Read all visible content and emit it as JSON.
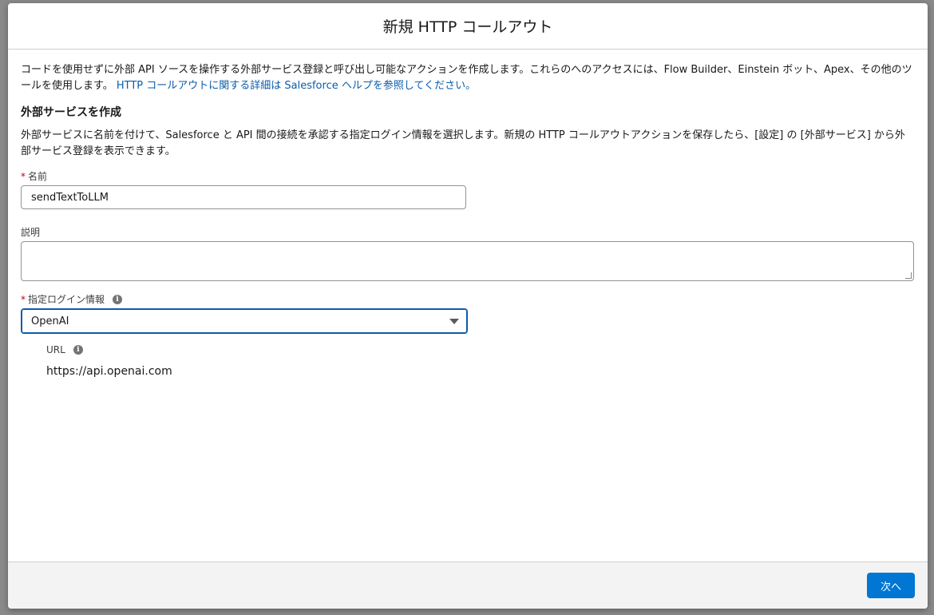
{
  "modal": {
    "title": "新規 HTTP コールアウト",
    "intro_text": "コードを使用せずに外部 API ソースを操作する外部サービス登録と呼び出し可能なアクションを作成します。これらのへのアクセスには、Flow Builder、Einstein ボット、Apex、その他のツールを使用します。",
    "intro_link": "HTTP コールアウトに関する詳細は Salesforce ヘルプを参照してください。",
    "section_title": "外部サービスを作成",
    "section_desc": "外部サービスに名前を付けて、Salesforce と API 間の接続を承認する指定ログイン情報を選択します。新規の HTTP コールアウトアクションを保存したら、[設定] の [外部サービス] から外部サービス登録を表示できます。",
    "fields": {
      "name_label": "名前",
      "name_value": "sendTextToLLM",
      "description_label": "説明",
      "description_value": "",
      "credential_label": "指定ログイン情報",
      "credential_value": "OpenAI",
      "url_label": "URL",
      "url_value": "https://api.openai.com"
    },
    "required_marker": "*",
    "info_glyph": "i",
    "next_button": "次へ"
  },
  "colors": {
    "brand_button": "#0176d3",
    "link": "#0b5cab",
    "required": "#ba0517"
  },
  "icons": [
    "info-icon",
    "chevron-down-icon"
  ]
}
